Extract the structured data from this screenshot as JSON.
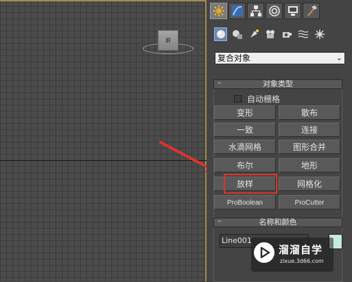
{
  "panel": {
    "tabs": [
      {
        "name": "create",
        "icon": "create-sun-icon",
        "active": true
      },
      {
        "name": "modify",
        "icon": "modify-curve-icon",
        "active": false
      },
      {
        "name": "hierarchy",
        "icon": "hierarchy-icon",
        "active": false
      },
      {
        "name": "motion",
        "icon": "motion-icon",
        "active": false
      },
      {
        "name": "display",
        "icon": "display-monitor-icon",
        "active": false
      },
      {
        "name": "utilities",
        "icon": "hammer-icon",
        "active": false
      }
    ],
    "subcategories": [
      {
        "icon": "geometry-icon",
        "active": true
      },
      {
        "icon": "shapes-icon",
        "active": false
      },
      {
        "icon": "lights-icon",
        "active": false
      },
      {
        "icon": "cameras-icon",
        "active": false
      },
      {
        "icon": "helpers-icon",
        "active": false
      },
      {
        "icon": "spacewarps-icon",
        "active": false
      },
      {
        "icon": "systems-icon",
        "active": false
      }
    ],
    "category_dropdown": {
      "selected": "复合对象"
    },
    "object_type": {
      "title": "对象类型",
      "collapse_symbol": "–",
      "autogrid_label": "自动栅格",
      "autogrid_checked": false,
      "buttons": [
        [
          "变形",
          "散布"
        ],
        [
          "一致",
          "连接"
        ],
        [
          "水滴网格",
          "图形合并"
        ],
        [
          "布尔",
          "地形"
        ],
        [
          "放样",
          "网格化"
        ],
        [
          "ProBoolean",
          "ProCutter"
        ]
      ],
      "highlighted_button": "放样"
    },
    "name_color": {
      "title": "名称和颜色",
      "collapse_symbol": "–",
      "name_value": "Line001",
      "swatch_color": "#c7ecd9"
    }
  },
  "viewport": {
    "viewcube_label": "前"
  },
  "annotation": {
    "arrow_color": "#e0332b",
    "highlight_color": "#e0332b"
  },
  "watermark": {
    "title": "溜溜自学",
    "url": "zixue.3d66.com"
  }
}
